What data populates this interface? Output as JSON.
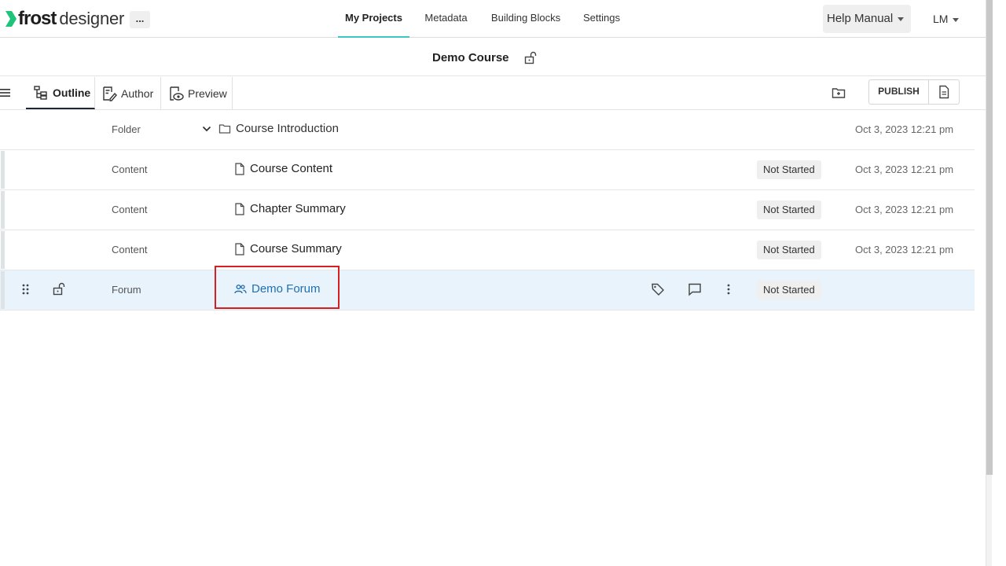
{
  "brand": {
    "name_bold": "frost",
    "name_light": "designer",
    "more_label": "...",
    "accent": "#1fc47a"
  },
  "nav": {
    "items": [
      {
        "label": "My Projects",
        "active": true
      },
      {
        "label": "Metadata"
      },
      {
        "label": "Building Blocks"
      },
      {
        "label": "Settings"
      }
    ],
    "help": "Help Manual",
    "user": "LM"
  },
  "course": {
    "title": "Demo Course"
  },
  "toolbar": {
    "tabs": [
      {
        "label": "Outline",
        "active": true
      },
      {
        "label": "Author"
      },
      {
        "label": "Preview"
      }
    ],
    "publish": "PUBLISH"
  },
  "rows": [
    {
      "type": "Folder",
      "name": "Course Introduction",
      "status": "",
      "date": "Oct 3, 2023 12:21 pm"
    },
    {
      "type": "Content",
      "name": "Course Content",
      "status": "Not Started",
      "date": "Oct 3, 2023 12:21 pm"
    },
    {
      "type": "Content",
      "name": "Chapter Summary",
      "status": "Not Started",
      "date": "Oct 3, 2023 12:21 pm"
    },
    {
      "type": "Content",
      "name": "Course Summary",
      "status": "Not Started",
      "date": "Oct 3, 2023 12:21 pm"
    },
    {
      "type": "Forum",
      "name": "Demo Forum",
      "status": "Not Started",
      "date": ""
    }
  ],
  "colors": {
    "link": "#1f6fb2",
    "active_tab_underline": "#3fc5c0",
    "selected_row": "#e9f3fb",
    "highlight": "#d42020"
  }
}
